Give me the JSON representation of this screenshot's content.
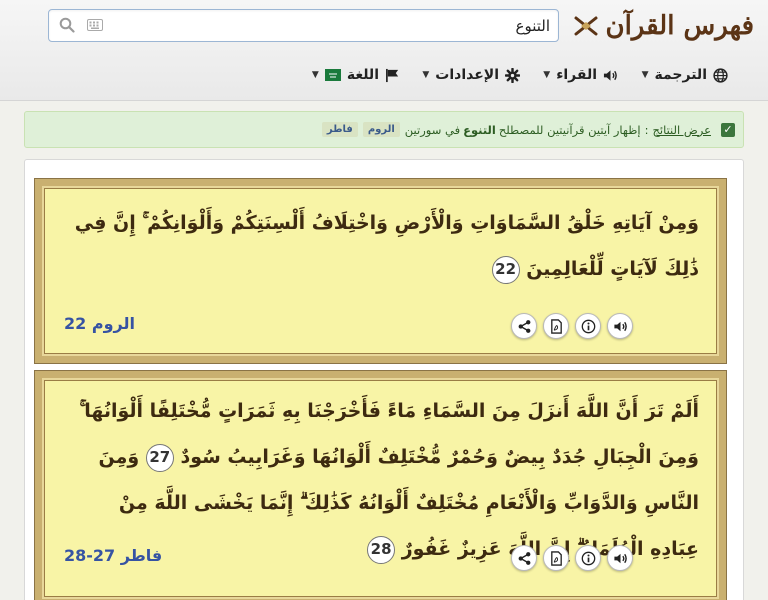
{
  "header": {
    "logo_text": "فهرس القرآن",
    "search": {
      "value": "التنوع",
      "placeholder": ""
    }
  },
  "nav": {
    "translation": "الترجمة",
    "reciters": "القراء",
    "settings": "الإعدادات",
    "language": "اللغة"
  },
  "info": {
    "lead": "عرض النتائج",
    "colon": ":",
    "text_before": "إظهار آيتين قرآنيتين للمصطلح",
    "term": "التنوع",
    "text_after": "في سورتين",
    "tags": [
      "الروم",
      "فاطر"
    ]
  },
  "verses": [
    {
      "text": "وَمِنْ آيَاتِهِ خَلْقُ السَّمَاوَاتِ وَالْأَرْضِ وَاخْتِلَافُ أَلْسِنَتِكُمْ وَأَلْوَانِكُمْ ۚ إِنَّ فِي ذَٰلِكَ لَآيَاتٍ لِّلْعَالِمِينَ",
      "number": "22",
      "reference": "الروم 22"
    },
    {
      "text_a": "أَلَمْ تَرَ أَنَّ اللَّهَ أَنزَلَ مِنَ السَّمَاءِ مَاءً فَأَخْرَجْنَا بِهِ ثَمَرَاتٍ مُّخْتَلِفًا أَلْوَانُهَا ۚ وَمِنَ الْجِبَالِ جُدَدٌ بِيضٌ وَحُمْرٌ مُّخْتَلِفٌ أَلْوَانُهَا وَغَرَابِيبُ سُودٌ",
      "number_a": "27",
      "text_b": "وَمِنَ النَّاسِ وَالدَّوَابِّ وَالْأَنْعَامِ مُخْتَلِفٌ أَلْوَانُهُ كَذَٰلِكَ ۗ إِنَّمَا يَخْشَى اللَّهَ مِنْ عِبَادِهِ الْعُلَمَاءُ ۗ إِنَّ اللَّهَ عَزِيزٌ غَفُورٌ",
      "number_b": "28",
      "reference": "فاطر 27-28"
    }
  ],
  "tool_icons": [
    "audio-icon",
    "info-icon",
    "pdf-icon",
    "share-icon"
  ],
  "colors": {
    "verse_bg": "#f8f4a6",
    "reference": "#3653a3",
    "info_bg": "#dff0d8",
    "logo": "#5b3416"
  }
}
